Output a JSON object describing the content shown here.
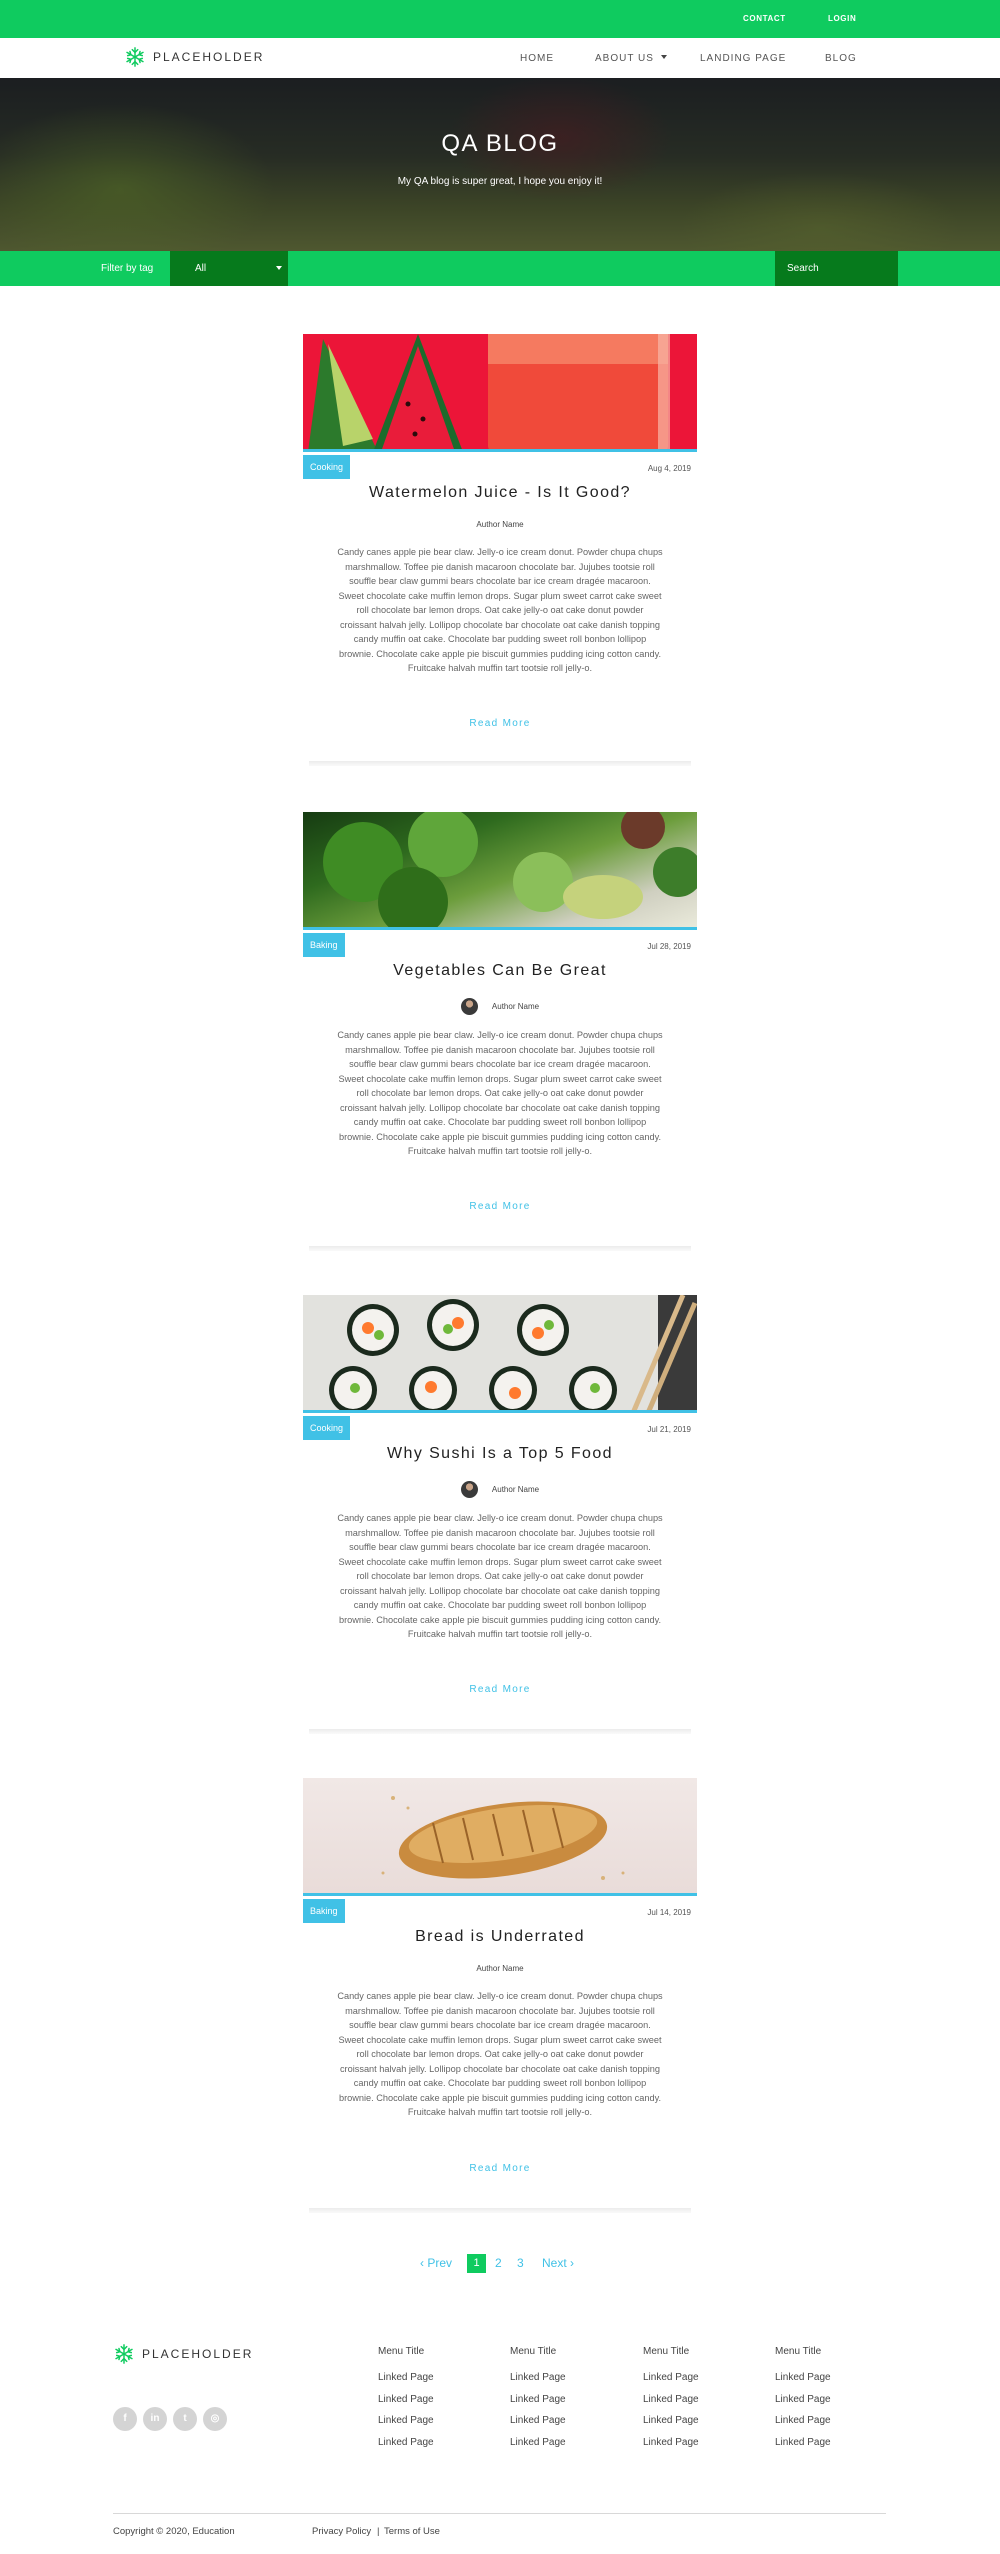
{
  "topbar": {
    "contact": "CONTACT",
    "login": "LOGIN"
  },
  "brand": {
    "name": "PLACEHOLDER",
    "logo_icon": "snowflake-logo-icon",
    "accent": "#0fcb5f"
  },
  "nav": {
    "home": "HOME",
    "about": "ABOUT US",
    "landing": "LANDING PAGE",
    "blog": "BLOG"
  },
  "hero": {
    "title": "QA BLOG",
    "subtitle": "My QA blog is super great, I hope you enjoy it!"
  },
  "filter": {
    "label": "Filter by tag",
    "selected": "All",
    "search_placeholder": "Search"
  },
  "posts": [
    {
      "tag": "Cooking",
      "date": "Aug 4, 2019",
      "title": "Watermelon Juice - Is It Good?",
      "author": "Author Name",
      "body": "Candy canes apple pie bear claw. Jelly-o ice cream donut. Powder chupa chups marshmallow. Toffee pie danish macaroon chocolate bar. Jujubes tootsie roll souffle bear claw gummi bears chocolate bar ice cream dragée macaroon. Sweet chocolate cake muffin lemon drops. Sugar plum sweet carrot cake sweet roll chocolate bar lemon drops. Oat cake jelly-o oat cake donut powder croissant halvah jelly. Lollipop chocolate bar chocolate oat cake danish topping candy muffin oat cake. Chocolate bar pudding sweet roll bonbon lollipop brownie. Chocolate cake apple pie biscuit gummies pudding icing cotton candy. Fruitcake halvah muffin tart tootsie roll jelly-o.",
      "read_more": "Read More"
    },
    {
      "tag": "Baking",
      "date": "Jul 28, 2019",
      "title": "Vegetables Can Be Great",
      "author": "Author Name",
      "body": "Candy canes apple pie bear claw. Jelly-o ice cream donut. Powder chupa chups marshmallow. Toffee pie danish macaroon chocolate bar. Jujubes tootsie roll souffle bear claw gummi bears chocolate bar ice cream dragée macaroon. Sweet chocolate cake muffin lemon drops. Sugar plum sweet carrot cake sweet roll chocolate bar lemon drops. Oat cake jelly-o oat cake donut powder croissant halvah jelly. Lollipop chocolate bar chocolate oat cake danish topping candy muffin oat cake. Chocolate bar pudding sweet roll bonbon lollipop brownie. Chocolate cake apple pie biscuit gummies pudding icing cotton candy. Fruitcake halvah muffin tart tootsie roll jelly-o.",
      "read_more": "Read More"
    },
    {
      "tag": "Cooking",
      "date": "Jul 21, 2019",
      "title": "Why Sushi Is a Top 5 Food",
      "author": "Author Name",
      "body": "Candy canes apple pie bear claw. Jelly-o ice cream donut. Powder chupa chups marshmallow. Toffee pie danish macaroon chocolate bar. Jujubes tootsie roll souffle bear claw gummi bears chocolate bar ice cream dragée macaroon. Sweet chocolate cake muffin lemon drops. Sugar plum sweet carrot cake sweet roll chocolate bar lemon drops. Oat cake jelly-o oat cake donut powder croissant halvah jelly. Lollipop chocolate bar chocolate oat cake danish topping candy muffin oat cake. Chocolate bar pudding sweet roll bonbon lollipop brownie. Chocolate cake apple pie biscuit gummies pudding icing cotton candy. Fruitcake halvah muffin tart tootsie roll jelly-o.",
      "read_more": "Read More"
    },
    {
      "tag": "Baking",
      "date": "Jul 14, 2019",
      "title": "Bread is Underrated",
      "author": "Author Name",
      "body": "Candy canes apple pie bear claw. Jelly-o ice cream donut. Powder chupa chups marshmallow. Toffee pie danish macaroon chocolate bar. Jujubes tootsie roll souffle bear claw gummi bears chocolate bar ice cream dragée macaroon. Sweet chocolate cake muffin lemon drops. Sugar plum sweet carrot cake sweet roll chocolate bar lemon drops. Oat cake jelly-o oat cake donut powder croissant halvah jelly. Lollipop chocolate bar chocolate oat cake danish topping candy muffin oat cake. Chocolate bar pudding sweet roll bonbon lollipop brownie. Chocolate cake apple pie biscuit gummies pudding icing cotton candy. Fruitcake halvah muffin tart tootsie roll jelly-o.",
      "read_more": "Read More"
    }
  ],
  "pagination": {
    "prev": "Prev",
    "pages": [
      "1",
      "2",
      "3"
    ],
    "current": "1",
    "next": "Next"
  },
  "footer": {
    "columns": [
      {
        "title": "Menu Title",
        "links": [
          "Linked Page",
          "Linked Page",
          "Linked Page",
          "Linked Page"
        ]
      },
      {
        "title": "Menu Title",
        "links": [
          "Linked Page",
          "Linked Page",
          "Linked Page",
          "Linked Page"
        ]
      },
      {
        "title": "Menu Title",
        "links": [
          "Linked Page",
          "Linked Page",
          "Linked Page",
          "Linked Page"
        ]
      },
      {
        "title": "Menu Title",
        "links": [
          "Linked Page",
          "Linked Page",
          "Linked Page",
          "Linked Page"
        ]
      }
    ],
    "social": [
      {
        "icon": "facebook-icon",
        "glyph": "f"
      },
      {
        "icon": "linkedin-icon",
        "glyph": "in"
      },
      {
        "icon": "twitter-icon",
        "glyph": "t"
      },
      {
        "icon": "instagram-icon",
        "glyph": "◎"
      }
    ],
    "copyright": "Copyright © 2020, Education",
    "privacy": "Privacy Policy",
    "divider": "|",
    "terms": "Terms of Use"
  }
}
